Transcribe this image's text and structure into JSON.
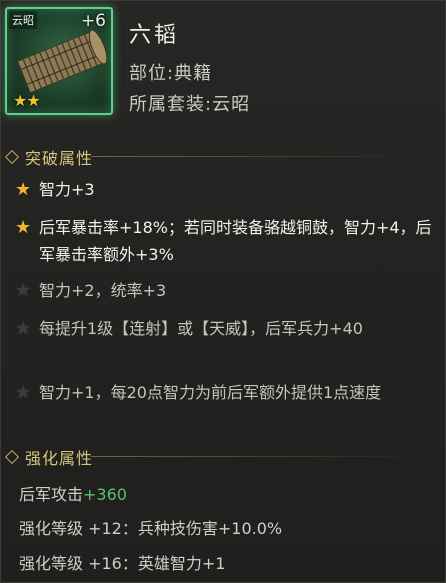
{
  "item": {
    "name": "六韬",
    "slot": "部位:典籍",
    "set": "所属套装:云昭",
    "set_tag": "云昭",
    "plus_level": "+6",
    "stars": "★★"
  },
  "breakthrough": {
    "title": "突破属性",
    "rows": [
      {
        "star": "★",
        "text": "智力+3",
        "active": true
      },
      {
        "star": "★",
        "text": "后军暴击率+18%；若同时装备骆越铜鼓，智力+4，后军暴击率额外+3%",
        "active": true
      },
      {
        "star": "★",
        "text": "智力+2，统率+3",
        "active": false
      },
      {
        "star": "★",
        "text": "每提升1级【连射】或【天威】，后军兵力+40",
        "active": false
      },
      {
        "star": "★",
        "text": "智力+1，每20点智力为前后军额外提供1点速度",
        "active": false
      }
    ]
  },
  "enhance": {
    "title": "强化属性",
    "main_label": "后军攻击",
    "main_value": "+360",
    "lines": [
      "强化等级 +12：兵种技伤害+10.0%",
      "强化等级 +16：英雄智力+1"
    ]
  }
}
